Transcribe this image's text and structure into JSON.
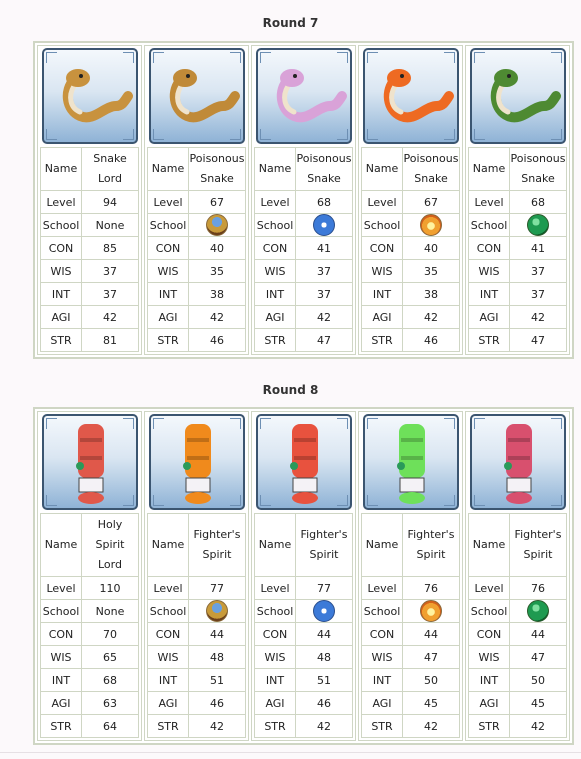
{
  "rounds": [
    {
      "title": "Round 7",
      "monsters": [
        {
          "name": "Snake Lord",
          "level": "94",
          "school": "None",
          "school_icon": null,
          "con": "85",
          "wis": "37",
          "int": "37",
          "agi": "42",
          "str": "81",
          "color": "#c8923e",
          "kind": "snake"
        },
        {
          "name": "Poisonous Snake",
          "level": "67",
          "school": "earth",
          "school_icon": "earth-school-icon",
          "con": "40",
          "wis": "35",
          "int": "38",
          "agi": "42",
          "str": "46",
          "color": "#c08a38",
          "kind": "snake"
        },
        {
          "name": "Poisonous Snake",
          "level": "68",
          "school": "water",
          "school_icon": "water-school-icon",
          "con": "41",
          "wis": "37",
          "int": "37",
          "agi": "42",
          "str": "47",
          "color": "#d9a2d8",
          "kind": "snake"
        },
        {
          "name": "Poisonous Snake",
          "level": "67",
          "school": "fire",
          "school_icon": "fire-school-icon",
          "con": "40",
          "wis": "35",
          "int": "38",
          "agi": "42",
          "str": "46",
          "color": "#ee6a22",
          "kind": "snake"
        },
        {
          "name": "Poisonous Snake",
          "level": "68",
          "school": "wood",
          "school_icon": "wood-school-icon",
          "con": "41",
          "wis": "37",
          "int": "37",
          "agi": "42",
          "str": "47",
          "color": "#4e8a32",
          "kind": "snake"
        }
      ]
    },
    {
      "title": "Round 8",
      "monsters": [
        {
          "name": "Holy Spirit Lord",
          "level": "110",
          "school": "None",
          "school_icon": null,
          "con": "70",
          "wis": "65",
          "int": "68",
          "agi": "63",
          "str": "64",
          "color": "#e0584a",
          "kind": "totem"
        },
        {
          "name": "Fighter's Spirit",
          "level": "77",
          "school": "earth",
          "school_icon": "earth-school-icon",
          "con": "44",
          "wis": "48",
          "int": "51",
          "agi": "46",
          "str": "42",
          "color": "#f08a1c",
          "kind": "totem"
        },
        {
          "name": "Fighter's Spirit",
          "level": "77",
          "school": "water",
          "school_icon": "water-school-icon",
          "con": "44",
          "wis": "48",
          "int": "51",
          "agi": "46",
          "str": "42",
          "color": "#e8523e",
          "kind": "totem"
        },
        {
          "name": "Fighter's Spirit",
          "level": "76",
          "school": "fire",
          "school_icon": "fire-school-icon",
          "con": "44",
          "wis": "47",
          "int": "50",
          "agi": "45",
          "str": "42",
          "color": "#6ee05a",
          "kind": "totem"
        },
        {
          "name": "Fighter's Spirit",
          "level": "76",
          "school": "wood",
          "school_icon": "wood-school-icon",
          "con": "44",
          "wis": "47",
          "int": "50",
          "agi": "45",
          "str": "42",
          "color": "#d8506e",
          "kind": "totem"
        }
      ]
    }
  ],
  "labels": {
    "name": "Name",
    "level": "Level",
    "school": "School",
    "con": "CON",
    "wis": "WIS",
    "int": "INT",
    "agi": "AGI",
    "str": "STR"
  }
}
